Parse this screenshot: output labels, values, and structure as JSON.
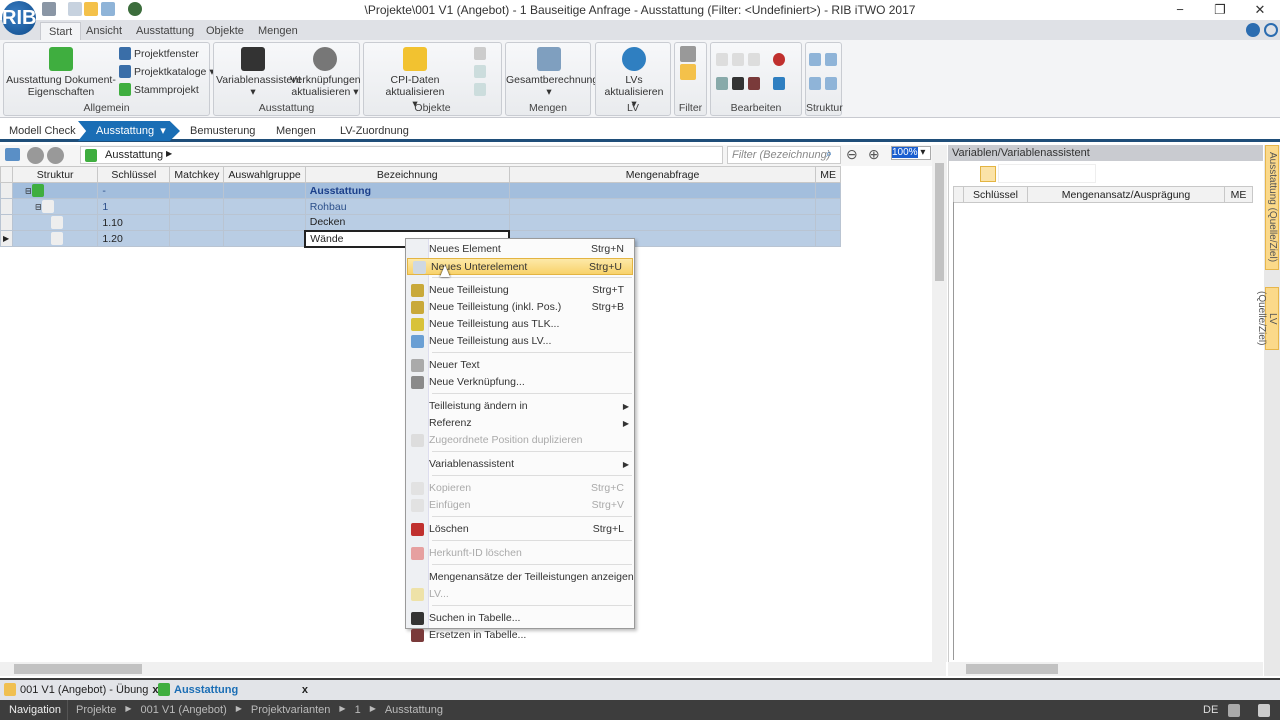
{
  "window": {
    "title": "\\Projekte\\001 V1 (Angebot) - 1 Bauseitige Anfrage - Ausstattung (Filter: <Undefiniert>) - RIB iTWO 2017",
    "minimize": "−",
    "restore": "❐",
    "close": "✕",
    "logo": "RIB"
  },
  "ribbon_tabs": [
    "Start",
    "Ansicht",
    "Ausstattung",
    "Objekte",
    "Mengen"
  ],
  "ribbon": {
    "allgemein": {
      "label": "Allgemein",
      "big": "Ausstattung Dokument-Eigenschaften",
      "small": [
        "Projektfenster",
        "Projektkataloge",
        "Stammprojekt"
      ]
    },
    "ausstattung": {
      "label": "Ausstattung",
      "btn1": "Variablenassistent",
      "btn2": "Verknüpfungen aktualisieren"
    },
    "objekte": {
      "label": "Objekte",
      "btn1": "CPI-Daten aktualisieren"
    },
    "mengen": {
      "label": "Mengen",
      "btn1": "Gesamtberechnung"
    },
    "lv": {
      "label": "LV",
      "btn1": "LVs aktualisieren"
    },
    "filter": {
      "label": "Filter"
    },
    "bearbeiten": {
      "label": "Bearbeiten"
    },
    "struktur": {
      "label": "Struktur"
    }
  },
  "workflow": [
    "Modell Check",
    "Ausstattung",
    "Bemusterung",
    "Mengen",
    "LV-Zuordnung"
  ],
  "toolbar": {
    "crumb": "Ausstattung",
    "filter_placeholder": "Filter (Bezeichnung)",
    "zoom": "100%"
  },
  "grid": {
    "columns": [
      "Struktur",
      "Schlüssel",
      "Matchkey",
      "Auswahlgruppe",
      "Bezeichnung",
      "Mengenabfrage",
      "ME"
    ],
    "rows": [
      {
        "key": "-",
        "name": "Ausstattung"
      },
      {
        "key": "1",
        "name": "Rohbau"
      },
      {
        "key": "1.10",
        "name": "Decken"
      },
      {
        "key": "1.20",
        "name": "Wände"
      }
    ]
  },
  "right_panel": {
    "title": "Variablen/Variablenassistent",
    "columns": [
      "Schlüssel",
      "Mengenansatz/Ausprägung",
      "ME"
    ],
    "side_tabs": [
      "Ausstattung (Quelle/Ziel)",
      "LV (Quelle/Ziel)"
    ]
  },
  "context_menu": [
    {
      "label": "Neues Element",
      "shortcut": "Strg+N"
    },
    {
      "label": "Neues Unterelement",
      "shortcut": "Strg+U",
      "highlight": true,
      "icon": "#cfd8e2"
    },
    {
      "sep": true
    },
    {
      "label": "Neue Teilleistung",
      "shortcut": "Strg+T",
      "icon": "#c9a93a"
    },
    {
      "label": "Neue Teilleistung (inkl. Pos.)",
      "shortcut": "Strg+B",
      "icon": "#c9a93a"
    },
    {
      "label": "Neue Teilleistung aus TLK...",
      "icon": "#d8c23a"
    },
    {
      "label": "Neue Teilleistung aus LV...",
      "icon": "#6a9fd4"
    },
    {
      "sep": true
    },
    {
      "label": "Neuer Text",
      "icon": "#aaaaaa"
    },
    {
      "label": "Neue Verknüpfung...",
      "icon": "#8a8a8a"
    },
    {
      "sep": true
    },
    {
      "label": "Teilleistung ändern in",
      "submenu": true
    },
    {
      "label": "Referenz",
      "submenu": true
    },
    {
      "label": "Zugeordnete Position duplizieren",
      "disabled": true,
      "icon": "#dddddd"
    },
    {
      "sep": true
    },
    {
      "label": "Variablenassistent",
      "submenu": true
    },
    {
      "sep": true
    },
    {
      "label": "Kopieren",
      "shortcut": "Strg+C",
      "disabled": true,
      "icon": "#e2e2e2"
    },
    {
      "label": "Einfügen",
      "shortcut": "Strg+V",
      "disabled": true,
      "icon": "#e2e2e2"
    },
    {
      "sep": true
    },
    {
      "label": "Löschen",
      "shortcut": "Strg+L",
      "icon": "#c0302e"
    },
    {
      "sep": true
    },
    {
      "label": "Herkunft-ID löschen",
      "disabled": true,
      "icon": "#e6a0a0"
    },
    {
      "sep": true
    },
    {
      "label": "Mengenansätze der Teilleistungen anzeigen"
    },
    {
      "label": "LV...",
      "disabled": true,
      "icon": "#eee2a8"
    },
    {
      "sep": true
    },
    {
      "label": "Suchen in Tabelle...",
      "icon": "#333333"
    },
    {
      "label": "Ersetzen in Tabelle...",
      "icon": "#7a3a3a"
    }
  ],
  "doc_tabs": [
    {
      "label": "001 V1 (Angebot) - Übung",
      "close": "x"
    },
    {
      "label": "Ausstattung",
      "close": "x"
    }
  ],
  "navigation": {
    "label": "Navigation",
    "path": [
      "Projekte",
      "001 V1 (Angebot)",
      "Projektvarianten",
      "1",
      "Ausstattung"
    ],
    "lang": "DE"
  },
  "colors": {
    "accent": "#1a6eb5",
    "row": "#b9cde4",
    "highlight": "#f8d26b",
    "nav": "#3d3d3d"
  }
}
